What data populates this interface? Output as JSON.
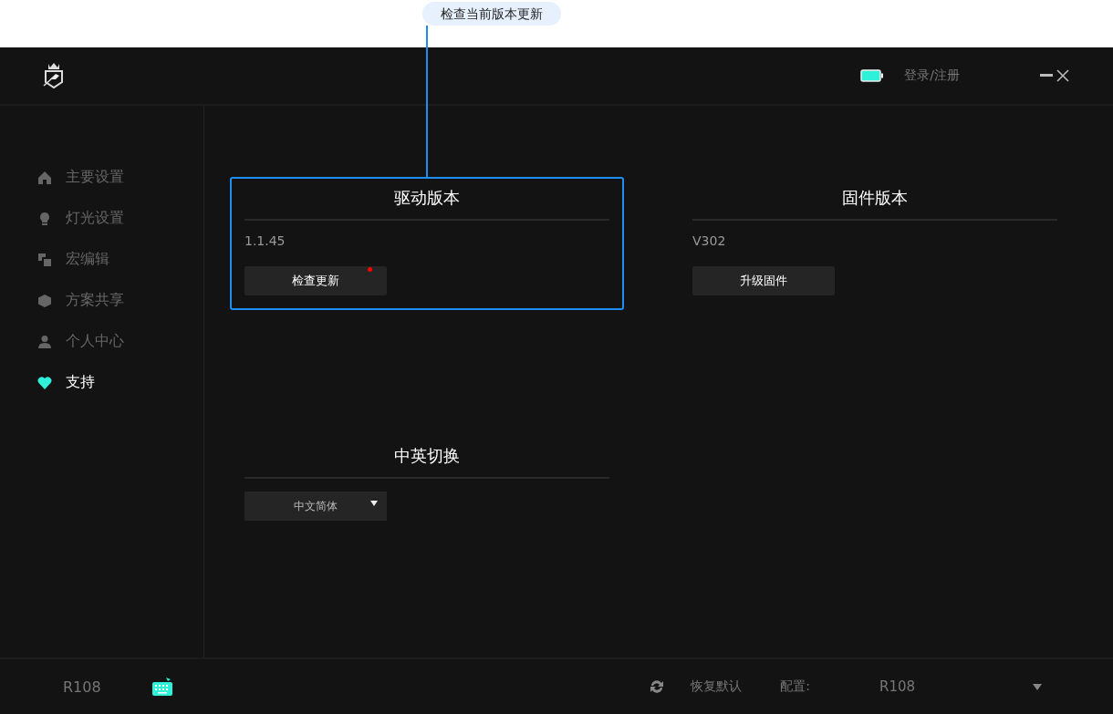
{
  "callout": {
    "text": "检查当前版本更新"
  },
  "header": {
    "login": "登录/注册"
  },
  "sidebar": {
    "items": [
      {
        "label": "主要设置",
        "selected": false
      },
      {
        "label": "灯光设置",
        "selected": false
      },
      {
        "label": "宏编辑",
        "selected": false
      },
      {
        "label": "方案共享",
        "selected": false
      },
      {
        "label": "个人中心",
        "selected": false
      },
      {
        "label": "支持",
        "selected": true
      }
    ]
  },
  "sections": [
    {
      "kind": "button",
      "title": "驱动版本",
      "value": "1.1.45",
      "button": "检查更新",
      "notification": true,
      "highlighted": true
    },
    {
      "kind": "button",
      "title": "固件版本",
      "value": "V302",
      "button": "升级固件",
      "notification": false,
      "highlighted": false
    },
    {
      "kind": "select",
      "title": "中英切换",
      "select": "中文简体",
      "highlighted": false
    }
  ],
  "footer": {
    "device": "R108",
    "restore": "恢复默认",
    "config_label": "配置:",
    "config_value": "R108"
  }
}
